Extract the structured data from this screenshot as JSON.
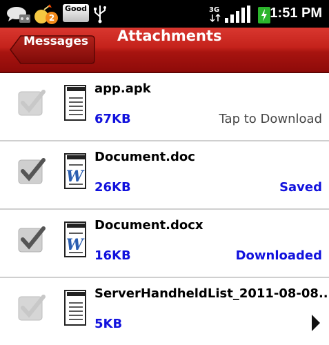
{
  "status_bar": {
    "notification_count": "2",
    "good_label": "Good",
    "network": "3G",
    "time": "1:51 PM"
  },
  "header": {
    "back_label": "Messages",
    "title": "Attachments"
  },
  "attachments": [
    {
      "name": "app.apk",
      "size": "67KB",
      "status": "Tap to Download",
      "checked": false,
      "icon": "generic-document-icon"
    },
    {
      "name": "Document.doc",
      "size": "26KB",
      "status": "Saved",
      "checked": true,
      "icon": "word-document-icon"
    },
    {
      "name": "Document.docx",
      "size": "16KB",
      "status": "Downloaded",
      "checked": true,
      "icon": "word-document-icon"
    },
    {
      "name": "ServerHandheldList_2011-08-08....",
      "size": "5KB",
      "status": "",
      "checked": false,
      "icon": "generic-document-icon"
    }
  ]
}
